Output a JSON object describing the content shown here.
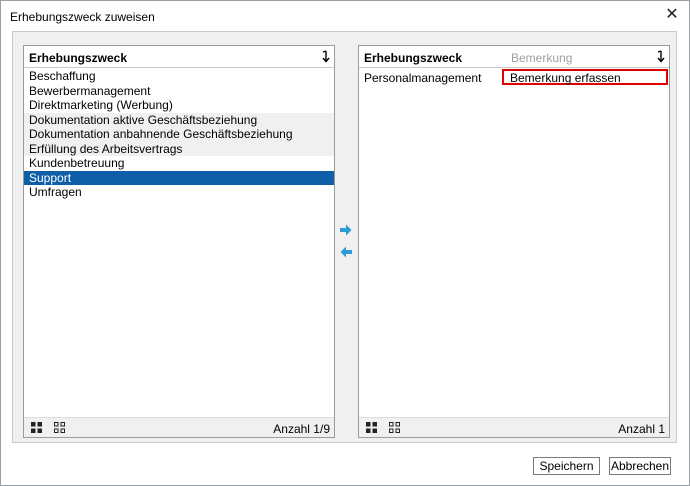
{
  "window": {
    "title": "Erhebungszweck zuweisen"
  },
  "left_panel": {
    "header": "Erhebungszweck",
    "items": [
      "Beschaffung",
      "Bewerbermanagement",
      "Direktmarketing (Werbung)",
      "Dokumentation aktive Geschäftsbeziehung",
      "Dokumentation anbahnende Geschäftsbeziehung",
      "Erfüllung des Arbeitsvertrags",
      "Kundenbetreuung",
      "Support",
      "Umfragen"
    ],
    "selected_item": "Support",
    "count": "Anzahl 1/9"
  },
  "right_panel": {
    "header_col1": "Erhebungszweck",
    "header_col2": "Bemerkung",
    "row_purpose": "Personalmanagement",
    "row_remark": "Bemerkung erfassen",
    "count": "Anzahl 1"
  },
  "buttons": {
    "save": "Speichern",
    "cancel": "Abbrechen"
  },
  "colors": {
    "selection": "#0f5fa8",
    "highlight_border": "#e00000",
    "arrow": "#2d9bd6"
  },
  "icons": [
    "close-icon",
    "sort-icon",
    "grid-view-icon",
    "list-view-icon",
    "move-right-arrow-icon",
    "move-left-arrow-icon"
  ]
}
